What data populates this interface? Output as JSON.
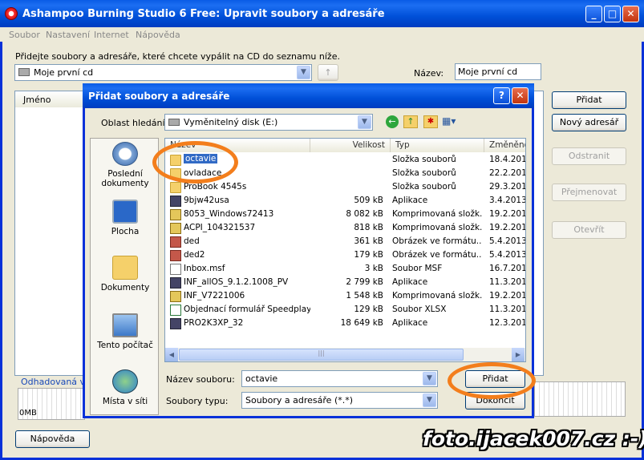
{
  "window": {
    "title": "Ashampoo Burning Studio 6 Free: Upravit soubory a adresáře",
    "minimize": "_",
    "maximize": "□",
    "close": "✕"
  },
  "menu": [
    "Soubor",
    "Nastavení",
    "Internet",
    "Nápověda"
  ],
  "main": {
    "instruction": "Přidejte soubory a adresáře, které chcete vypálit na CD do seznamu níže.",
    "location": "Moje první cd",
    "name_label": "Název:",
    "name_value": "Moje první cd",
    "column_name": "Jméno",
    "estimate_label": "Odhadovaná ve",
    "scale_zero": "0MB",
    "help_button": "Nápověda",
    "buttons": {
      "add": "Přidat",
      "new_folder": "Nový adresář",
      "remove": "Odstranit",
      "rename": "Přejmenovat",
      "open": "Otevřít"
    }
  },
  "dialog": {
    "title": "Přidat soubory a adresáře",
    "help": "?",
    "close": "✕",
    "lookin_label": "Oblast hledání:",
    "lookin_value": "Vyměnitelný disk (E:)",
    "places": [
      {
        "label": "Poslední dokumenty",
        "icon": "recent-documents-icon"
      },
      {
        "label": "Plocha",
        "icon": "desktop-icon"
      },
      {
        "label": "Dokumenty",
        "icon": "documents-icon"
      },
      {
        "label": "Tento počítač",
        "icon": "my-computer-icon"
      },
      {
        "label": "Místa v síti",
        "icon": "network-places-icon"
      }
    ],
    "columns": {
      "name": "Název",
      "size": "Velikost",
      "type": "Typ",
      "modified": "Změněno"
    },
    "files": [
      {
        "name": "octavie",
        "size": "",
        "type": "Složka souborů",
        "date": "18.4.201",
        "icon": "folder"
      },
      {
        "name": "ovladace",
        "size": "",
        "type": "Složka souborů",
        "date": "22.2.201",
        "icon": "folder"
      },
      {
        "name": "ProBook 4545s",
        "size": "",
        "type": "Složka souborů",
        "date": "29.3.201",
        "icon": "folder"
      },
      {
        "name": "9bjw42usa",
        "size": "509 kB",
        "type": "Aplikace",
        "date": "3.4.2013",
        "icon": "exe"
      },
      {
        "name": "8053_Windows72413",
        "size": "8 082 kB",
        "type": "Komprimovaná složk...",
        "date": "19.2.201",
        "icon": "zip"
      },
      {
        "name": "ACPI_104321537",
        "size": "818 kB",
        "type": "Komprimovaná složk...",
        "date": "19.2.201",
        "icon": "zip"
      },
      {
        "name": "ded",
        "size": "361 kB",
        "type": "Obrázek ve formátu...",
        "date": "5.4.2013",
        "icon": "img"
      },
      {
        "name": "ded2",
        "size": "179 kB",
        "type": "Obrázek ve formátu...",
        "date": "5.4.2013",
        "icon": "img"
      },
      {
        "name": "Inbox.msf",
        "size": "3 kB",
        "type": "Soubor MSF",
        "date": "16.7.201",
        "icon": "doc"
      },
      {
        "name": "INF_allOS_9.1.2.1008_PV",
        "size": "2 799 kB",
        "type": "Aplikace",
        "date": "11.3.201",
        "icon": "exe"
      },
      {
        "name": "INF_V7221006",
        "size": "1 548 kB",
        "type": "Komprimovaná složk...",
        "date": "19.2.201",
        "icon": "zip"
      },
      {
        "name": "Objednací formulář Speedplay...",
        "size": "129 kB",
        "type": "Soubor XLSX",
        "date": "11.3.201",
        "icon": "xls"
      },
      {
        "name": "PRO2K3XP_32",
        "size": "18 649 kB",
        "type": "Aplikace",
        "date": "12.3.201",
        "icon": "exe"
      }
    ],
    "filename_label": "Název souboru:",
    "filename_value": "octavie",
    "filetype_label": "Soubory typu:",
    "filetype_value": "Soubory a adresáře (*.*)",
    "add_button": "Přidat",
    "cancel_button": "Dokončit"
  },
  "watermark": "foto.ijacek007.cz :-)",
  "colors": {
    "titlebar": "#0054e3",
    "highlight": "#316ac5",
    "annotation": "#f37e1c"
  }
}
